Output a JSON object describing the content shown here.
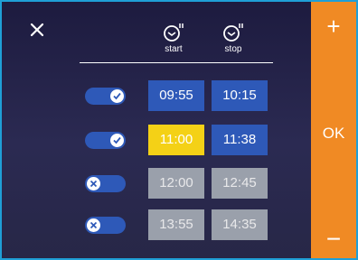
{
  "columns": {
    "start_label": "start",
    "stop_label": "stop"
  },
  "side": {
    "plus": "+",
    "ok": "OK",
    "minus": "−"
  },
  "rows": [
    {
      "enabled": true,
      "start": "09:55",
      "stop": "10:15"
    },
    {
      "enabled": true,
      "start": "11:00",
      "stop": "11:38",
      "start_highlight": true
    },
    {
      "enabled": false,
      "start": "12:00",
      "stop": "12:45"
    },
    {
      "enabled": false,
      "start": "13:55",
      "stop": "14:35"
    }
  ],
  "colors": {
    "frame": "#1f9fd6",
    "sidebar": "#f08a24",
    "time_blue": "#2e59b8",
    "time_selected": "#f4d116",
    "time_disabled": "#9aa0ab"
  }
}
